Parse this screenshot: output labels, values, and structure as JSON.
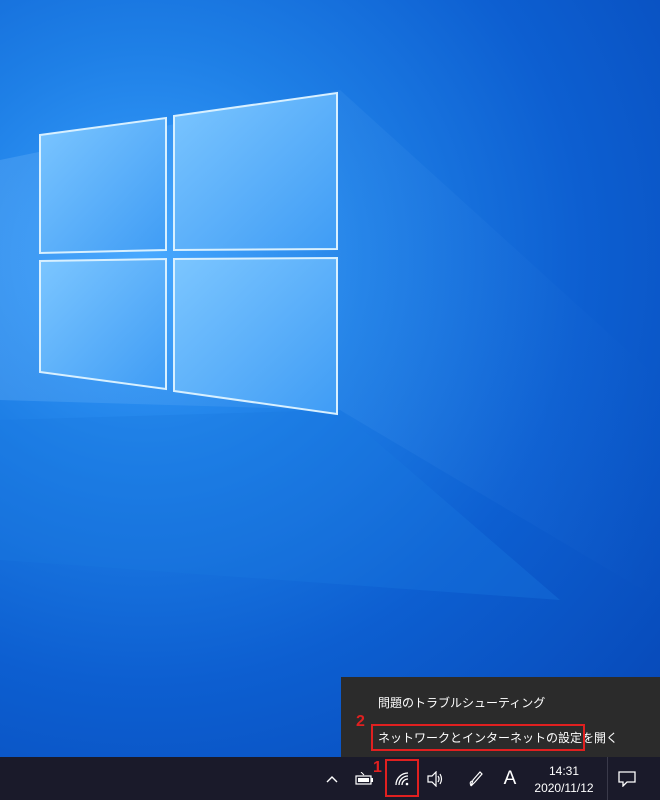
{
  "context_menu": {
    "items": [
      {
        "label": "問題のトラブルシューティング"
      },
      {
        "label": "ネットワークとインターネットの設定を開く"
      }
    ]
  },
  "annotations": {
    "step1": "1",
    "step2": "2",
    "highlight_color": "#e02020"
  },
  "taskbar": {
    "tray_icons": [
      "chevron-up-icon",
      "battery-icon",
      "wifi-icon",
      "volume-icon",
      "pen-icon"
    ],
    "ime_label": "A",
    "time": "14:31",
    "date": "2020/11/12",
    "notification_icon": "action-center-icon"
  },
  "colors": {
    "desktop_blue": "#0d5fd1",
    "taskbar": "#1a1a2a",
    "menu_bg": "#2b2b2b"
  }
}
